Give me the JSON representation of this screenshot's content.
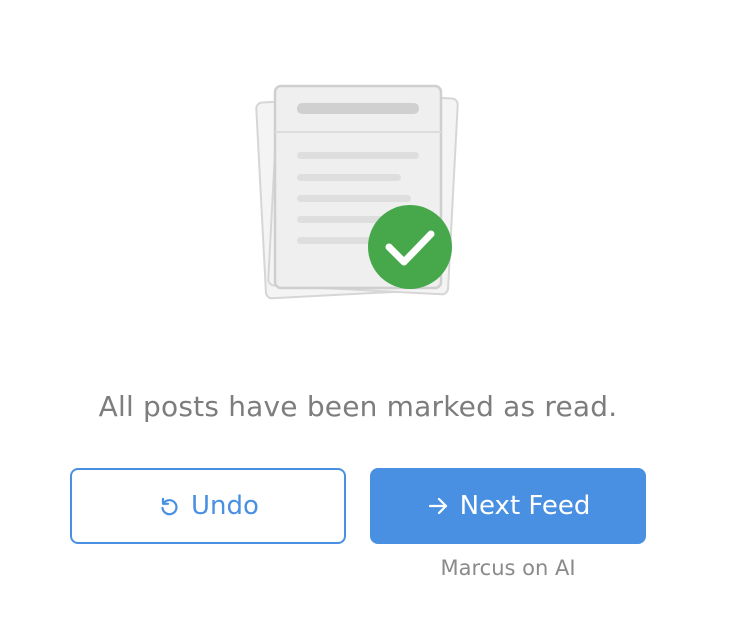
{
  "illustration": {
    "document_icon": "stacked-documents-icon",
    "check_icon": "checkmark-circle-icon",
    "check_color": "#46a84a"
  },
  "message": "All posts have been marked as read.",
  "actions": {
    "undo_label": "Undo",
    "undo_icon": "undo-icon",
    "next_label": "Next Feed",
    "next_icon": "arrow-right-icon",
    "next_feed_name": "Marcus on AI"
  },
  "colors": {
    "accent": "#4a90e2",
    "muted_text": "#7d7d7d"
  }
}
